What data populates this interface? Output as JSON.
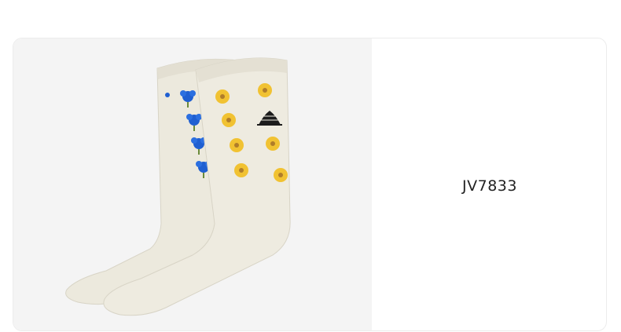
{
  "product": {
    "code": "JV7833",
    "image_subject": "socks-icon"
  },
  "colors": {
    "sock_base": "#ece9dd",
    "sock_shadow": "#dcd8ca",
    "flower_blue": "#1f5fd1",
    "flower_yellow": "#f1c232",
    "flower_center": "#b07d2a",
    "stem_green": "#6a8a3a",
    "logo_black": "#1c1c1c",
    "image_background": "#f4f4f4"
  }
}
